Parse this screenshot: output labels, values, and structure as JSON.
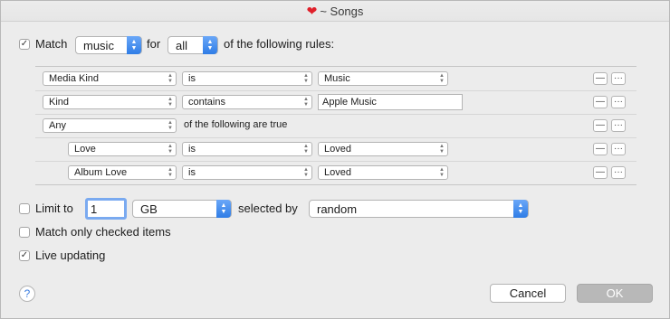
{
  "window": {
    "title": "~ Songs",
    "title_icon": "heart-icon"
  },
  "match": {
    "checkbox_checked": true,
    "label": "Match",
    "media_value": "music",
    "for_label": "for",
    "quantifier_value": "all",
    "suffix": "of the following rules:"
  },
  "rules": [
    {
      "field": "Media Kind",
      "operator": "is",
      "value": "Music",
      "value_type": "popup",
      "indent": 0
    },
    {
      "field": "Kind",
      "operator": "contains",
      "value": "Apple Music",
      "value_type": "text",
      "indent": 0
    },
    {
      "field": "Any",
      "nested_text": "of the following are true",
      "indent": 0
    },
    {
      "field": "Love",
      "operator": "is",
      "value": "Loved",
      "value_type": "popup",
      "indent": 1
    },
    {
      "field": "Album Love",
      "operator": "is",
      "value": "Loved",
      "value_type": "popup",
      "indent": 1
    }
  ],
  "rule_buttons": {
    "remove": "—",
    "more": "···"
  },
  "limit": {
    "checkbox_checked": false,
    "label": "Limit to",
    "amount": "1",
    "unit": "GB",
    "selected_by_label": "selected by",
    "selected_by_value": "random"
  },
  "match_checked": {
    "checkbox_checked": false,
    "label": "Match only checked items"
  },
  "live_updating": {
    "checkbox_checked": true,
    "label": "Live updating"
  },
  "footer": {
    "help": "?",
    "cancel": "Cancel",
    "ok": "OK"
  },
  "colors": {
    "accent": "#2f7de6",
    "heart": "#e0202a"
  }
}
